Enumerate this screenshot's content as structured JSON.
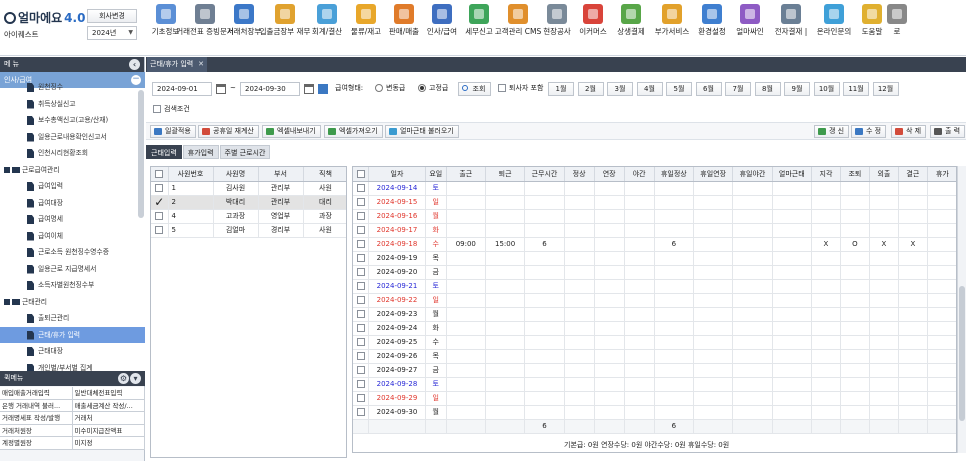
{
  "header": {
    "logo_text": "얼마에요",
    "logo_version": "4.0",
    "company_button": "회사변경",
    "company_name": "아이퀘스트",
    "year": "2024년"
  },
  "top_menu": [
    {
      "label": "기초정보",
      "icon": "basic-info-icon",
      "color": "#5b8fd6"
    },
    {
      "label": "거래전표 증빙문서",
      "icon": "voucher-icon",
      "color": "#6f7f93"
    },
    {
      "label": "거래처장부",
      "icon": "ledger-icon",
      "color": "#3c78c8"
    },
    {
      "label": "입출금장부 재무",
      "icon": "cashbook-icon",
      "color": "#e0a22f"
    },
    {
      "label": "회계/결산",
      "icon": "accounting-icon",
      "color": "#4aa0d8"
    },
    {
      "label": "물류/재고",
      "icon": "logistics-icon",
      "color": "#e8a72a"
    },
    {
      "label": "판매/매출",
      "icon": "sales-icon",
      "color": "#e07b2a"
    },
    {
      "label": "인사/급여",
      "icon": "hr-icon",
      "color": "#3e6ec0"
    },
    {
      "label": "세무신고",
      "icon": "tax-icon",
      "color": "#3ea55a"
    },
    {
      "label": "고객관리 CMS",
      "icon": "customer-icon",
      "color": "#e08f2c"
    },
    {
      "label": "현장공사",
      "icon": "construction-icon",
      "color": "#7a8a99"
    },
    {
      "label": "이커머스",
      "icon": "ecommerce-icon",
      "color": "#d9443a"
    },
    {
      "label": "상생결제",
      "icon": "payment-icon",
      "color": "#58a648"
    },
    {
      "label": "부가서비스",
      "icon": "service-icon",
      "color": "#e2a12b"
    },
    {
      "label": "환경설정",
      "icon": "settings-icon",
      "color": "#3f7fd0"
    },
    {
      "label": "얼마싸인",
      "icon": "sign-icon",
      "color": "#8e5bc4"
    },
    {
      "label": "전자결재 |",
      "icon": "approval-icon",
      "color": "#6a7f95"
    },
    {
      "label": "온라인문의",
      "icon": "online-inquiry-icon",
      "color": "#3fa0d8"
    },
    {
      "label": "도움말",
      "icon": "help-icon",
      "color": "#e0b030"
    },
    {
      "label": "로",
      "icon": "logout-icon",
      "color": "#888888"
    }
  ],
  "left_panel": {
    "title": "메 뉴",
    "section": "인사/급여",
    "tree": [
      {
        "label": "원천징수",
        "type": "doc"
      },
      {
        "label": "취득상실신고",
        "type": "doc"
      },
      {
        "label": "보수총액신고(고용/산재)",
        "type": "doc"
      },
      {
        "label": "일용근로내용확인신고서",
        "type": "doc"
      },
      {
        "label": "인천시리현황조회",
        "type": "doc"
      },
      {
        "label": "근로급여관리",
        "type": "folder"
      },
      {
        "label": "급여입력",
        "type": "doc"
      },
      {
        "label": "급여대장",
        "type": "doc"
      },
      {
        "label": "급여명세",
        "type": "doc"
      },
      {
        "label": "급여이체",
        "type": "doc"
      },
      {
        "label": "근로소득 원천징수영수증",
        "type": "doc"
      },
      {
        "label": "일용근로 지급명세서",
        "type": "doc"
      },
      {
        "label": "소득자별원천징수부",
        "type": "doc"
      },
      {
        "label": "근태관리",
        "type": "folder"
      },
      {
        "label": "출퇴근관리",
        "type": "doc"
      },
      {
        "label": "근태/휴가 입력",
        "type": "doc",
        "selected": true
      },
      {
        "label": "근태대장",
        "type": "doc"
      },
      {
        "label": "개인별/부서별 집계",
        "type": "doc"
      },
      {
        "label": "퇴직금관리",
        "type": "folder"
      }
    ],
    "quick_title": "퀵메뉴",
    "quick_menu": [
      [
        "매입매출거래입력",
        "일반대체전표입력"
      ],
      [
        "은행 거래내역 불러...",
        "매출세금계산 작성/..."
      ],
      [
        "거래명세표 작성/발행",
        "거래처"
      ],
      [
        "거래처원장",
        "미수미지급잔액표"
      ],
      [
        "계정별원장",
        "미지정"
      ]
    ]
  },
  "doc_tab": "근태/휴가 입력",
  "filter": {
    "date_from": "2024-09-01",
    "tilde": "~",
    "date_to": "2024-09-30",
    "pay_type_label": "급여형태:",
    "pay_variable": "변동급",
    "pay_fixed": "고정급",
    "search_button": "조회",
    "include_retired": "퇴사자 포함",
    "months": [
      "1월",
      "2월",
      "3월",
      "4월",
      "5월",
      "6월",
      "7월",
      "8월",
      "9월",
      "10월",
      "11월",
      "12월"
    ],
    "search_condition": "검색조건"
  },
  "toolbar": {
    "batch_apply": "일괄적용",
    "holiday_setting": "공휴일 재계산",
    "excel_export": "엑셀내보내기",
    "excel_import": "엑셀가져오기",
    "load_attendance": "얼마근태 불러오기",
    "refresh": "갱 신",
    "edit": "수 정",
    "delete": "삭 제",
    "print": "출 력"
  },
  "sub_tabs": [
    "근태입력",
    "휴가입력",
    "주별 근로시간"
  ],
  "employees": {
    "columns": [
      "사원번호",
      "사원명",
      "부서",
      "직책"
    ],
    "rows": [
      {
        "no": "1",
        "name": "김사원",
        "dept": "관리부",
        "title": "사원",
        "checked": false
      },
      {
        "no": "2",
        "name": "박대리",
        "dept": "관리부",
        "title": "대리",
        "checked": true
      },
      {
        "no": "4",
        "name": "고과장",
        "dept": "영업부",
        "title": "과장",
        "checked": false
      },
      {
        "no": "5",
        "name": "김얼마",
        "dept": "경리부",
        "title": "사원",
        "checked": false
      }
    ]
  },
  "attendance": {
    "columns": [
      "일자",
      "요일",
      "출근",
      "퇴근",
      "근무시간",
      "정상",
      "연장",
      "야간",
      "휴일정상",
      "휴일연장",
      "휴일야간",
      "얼마근태",
      "지각",
      "조퇴",
      "외출",
      "결근",
      "휴가"
    ],
    "rows": [
      {
        "date": "2024-09-14",
        "day": "토",
        "kind": "sat",
        "in": "",
        "out": "",
        "hours": "",
        "holiday": "",
        "late": "",
        "early": "",
        "out2": "",
        "absent": ""
      },
      {
        "date": "2024-09-15",
        "day": "일",
        "kind": "sun",
        "in": "",
        "out": "",
        "hours": "",
        "holiday": "",
        "late": "",
        "early": "",
        "out2": "",
        "absent": ""
      },
      {
        "date": "2024-09-16",
        "day": "월",
        "kind": "sun",
        "in": "",
        "out": "",
        "hours": "",
        "holiday": "",
        "late": "",
        "early": "",
        "out2": "",
        "absent": ""
      },
      {
        "date": "2024-09-17",
        "day": "화",
        "kind": "sun",
        "in": "",
        "out": "",
        "hours": "",
        "holiday": "",
        "late": "",
        "early": "",
        "out2": "",
        "absent": ""
      },
      {
        "date": "2024-09-18",
        "day": "수",
        "kind": "sun",
        "in": "09:00",
        "out": "15:00",
        "hours": "6",
        "holiday": "6",
        "late": "X",
        "early": "O",
        "out2": "X",
        "absent": "X"
      },
      {
        "date": "2024-09-19",
        "day": "목",
        "kind": "",
        "in": "",
        "out": "",
        "hours": "",
        "holiday": "",
        "late": "",
        "early": "",
        "out2": "",
        "absent": ""
      },
      {
        "date": "2024-09-20",
        "day": "금",
        "kind": "",
        "in": "",
        "out": "",
        "hours": "",
        "holiday": "",
        "late": "",
        "early": "",
        "out2": "",
        "absent": ""
      },
      {
        "date": "2024-09-21",
        "day": "토",
        "kind": "sat",
        "in": "",
        "out": "",
        "hours": "",
        "holiday": "",
        "late": "",
        "early": "",
        "out2": "",
        "absent": ""
      },
      {
        "date": "2024-09-22",
        "day": "일",
        "kind": "sun",
        "in": "",
        "out": "",
        "hours": "",
        "holiday": "",
        "late": "",
        "early": "",
        "out2": "",
        "absent": ""
      },
      {
        "date": "2024-09-23",
        "day": "월",
        "kind": "",
        "in": "",
        "out": "",
        "hours": "",
        "holiday": "",
        "late": "",
        "early": "",
        "out2": "",
        "absent": ""
      },
      {
        "date": "2024-09-24",
        "day": "화",
        "kind": "",
        "in": "",
        "out": "",
        "hours": "",
        "holiday": "",
        "late": "",
        "early": "",
        "out2": "",
        "absent": ""
      },
      {
        "date": "2024-09-25",
        "day": "수",
        "kind": "",
        "in": "",
        "out": "",
        "hours": "",
        "holiday": "",
        "late": "",
        "early": "",
        "out2": "",
        "absent": ""
      },
      {
        "date": "2024-09-26",
        "day": "목",
        "kind": "",
        "in": "",
        "out": "",
        "hours": "",
        "holiday": "",
        "late": "",
        "early": "",
        "out2": "",
        "absent": ""
      },
      {
        "date": "2024-09-27",
        "day": "금",
        "kind": "",
        "in": "",
        "out": "",
        "hours": "",
        "holiday": "",
        "late": "",
        "early": "",
        "out2": "",
        "absent": ""
      },
      {
        "date": "2024-09-28",
        "day": "토",
        "kind": "sat",
        "in": "",
        "out": "",
        "hours": "",
        "holiday": "",
        "late": "",
        "early": "",
        "out2": "",
        "absent": ""
      },
      {
        "date": "2024-09-29",
        "day": "일",
        "kind": "sun",
        "in": "",
        "out": "",
        "hours": "",
        "holiday": "",
        "late": "",
        "early": "",
        "out2": "",
        "absent": ""
      },
      {
        "date": "2024-09-30",
        "day": "월",
        "kind": "",
        "in": "",
        "out": "",
        "hours": "",
        "holiday": "",
        "late": "",
        "early": "",
        "out2": "",
        "absent": ""
      }
    ],
    "total": {
      "hours": "6",
      "holiday": "6"
    },
    "status": "기본급: 0원    연장수당: 0원    야간수당: 0원    휴일수당: 0원"
  },
  "colors": {
    "dark_header": "#394250",
    "accent": "#6e9be0",
    "saturday": "#2727d6",
    "sunday": "#e0362c"
  }
}
